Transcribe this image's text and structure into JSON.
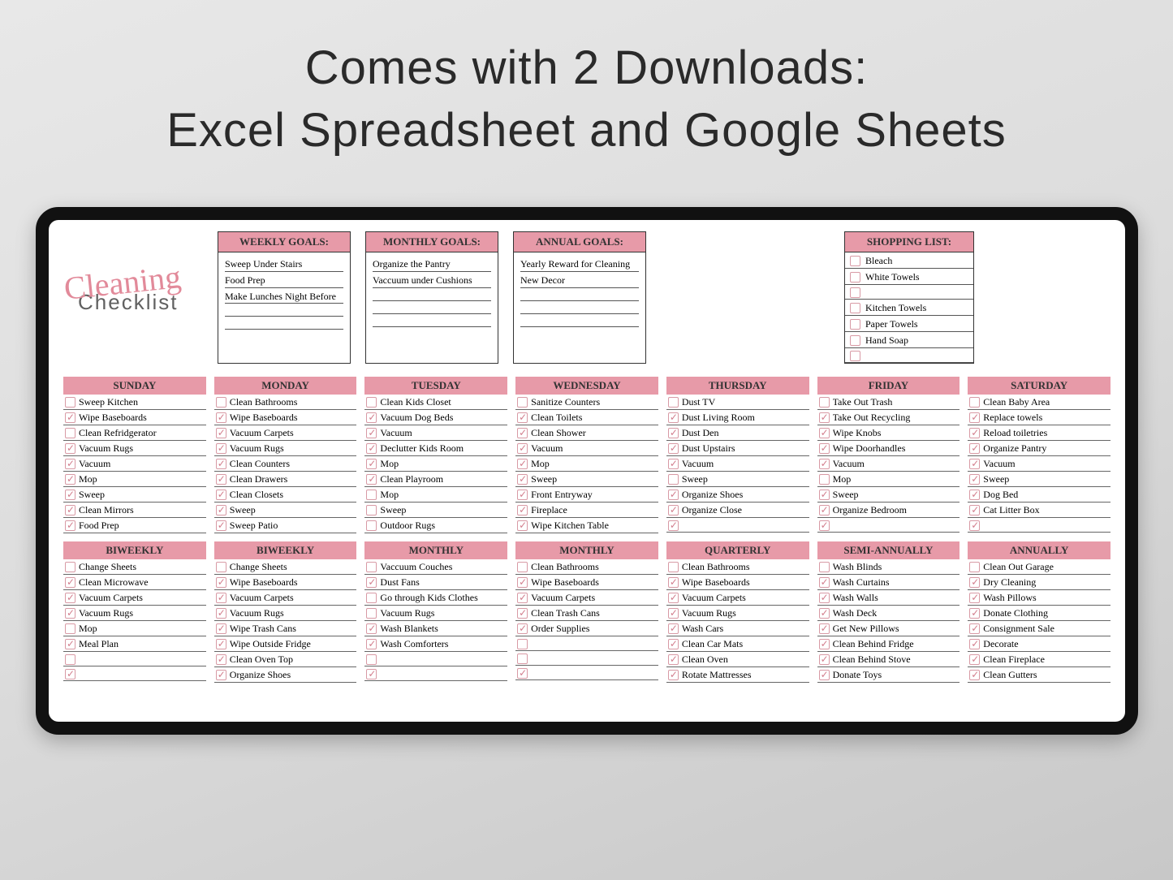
{
  "hero": {
    "line1": "Comes with 2 Downloads:",
    "line2": "Excel Spreadsheet and Google Sheets"
  },
  "logo": {
    "script": "Cleaning",
    "sub": "Checklist"
  },
  "goals": {
    "weekly": {
      "title": "WEEKLY GOALS:",
      "items": [
        "Sweep Under Stairs",
        "Food Prep",
        "Make Lunches Night Before",
        "",
        ""
      ]
    },
    "monthly": {
      "title": "MONTHLY GOALS:",
      "items": [
        "Organize the Pantry",
        "Vaccuum under Cushions",
        "",
        "",
        ""
      ]
    },
    "annual": {
      "title": "ANNUAL GOALS:",
      "items": [
        "Yearly Reward for Cleaning",
        "New Decor",
        "",
        "",
        ""
      ]
    }
  },
  "shopping": {
    "title": "SHOPPING LIST:",
    "items": [
      {
        "c": false,
        "t": "Bleach"
      },
      {
        "c": false,
        "t": "White Towels"
      },
      {
        "c": false,
        "t": ""
      },
      {
        "c": false,
        "t": "Kitchen Towels"
      },
      {
        "c": false,
        "t": "Paper Towels"
      },
      {
        "c": false,
        "t": "Hand Soap"
      },
      {
        "c": false,
        "t": ""
      }
    ]
  },
  "days": [
    {
      "h": "SUNDAY",
      "rows": [
        {
          "c": 0,
          "t": "Sweep Kitchen"
        },
        {
          "c": 1,
          "t": "Wipe Baseboards"
        },
        {
          "c": 0,
          "t": "Clean Refridgerator"
        },
        {
          "c": 1,
          "t": "Vacuum Rugs"
        },
        {
          "c": 1,
          "t": "Vacuum"
        },
        {
          "c": 1,
          "t": "Mop"
        },
        {
          "c": 1,
          "t": "Sweep"
        },
        {
          "c": 1,
          "t": "Clean Mirrors"
        },
        {
          "c": 1,
          "t": "Food Prep"
        }
      ]
    },
    {
      "h": "MONDAY",
      "rows": [
        {
          "c": 0,
          "t": "Clean Bathrooms"
        },
        {
          "c": 1,
          "t": "Wipe Baseboards"
        },
        {
          "c": 1,
          "t": "Vacuum Carpets"
        },
        {
          "c": 1,
          "t": "Vacuum Rugs"
        },
        {
          "c": 1,
          "t": "Clean Counters"
        },
        {
          "c": 1,
          "t": "Clean Drawers"
        },
        {
          "c": 1,
          "t": "Clean Closets"
        },
        {
          "c": 1,
          "t": "Sweep"
        },
        {
          "c": 1,
          "t": "Sweep Patio"
        }
      ]
    },
    {
      "h": "TUESDAY",
      "rows": [
        {
          "c": 0,
          "t": "Clean Kids Closet"
        },
        {
          "c": 1,
          "t": "Vacuum Dog Beds"
        },
        {
          "c": 1,
          "t": "Vacuum"
        },
        {
          "c": 1,
          "t": "Declutter Kids Room"
        },
        {
          "c": 1,
          "t": "Mop"
        },
        {
          "c": 1,
          "t": "Clean Playroom"
        },
        {
          "c": 0,
          "t": "Mop"
        },
        {
          "c": 0,
          "t": "Sweep"
        },
        {
          "c": 0,
          "t": "Outdoor Rugs"
        }
      ]
    },
    {
      "h": "WEDNESDAY",
      "rows": [
        {
          "c": 0,
          "t": "Sanitize Counters"
        },
        {
          "c": 1,
          "t": "Clean Toilets"
        },
        {
          "c": 1,
          "t": "Clean Shower"
        },
        {
          "c": 1,
          "t": "Vacuum"
        },
        {
          "c": 1,
          "t": "Mop"
        },
        {
          "c": 1,
          "t": "Sweep"
        },
        {
          "c": 1,
          "t": "Front Entryway"
        },
        {
          "c": 1,
          "t": "Fireplace"
        },
        {
          "c": 1,
          "t": "Wipe Kitchen Table"
        }
      ]
    },
    {
      "h": "THURSDAY",
      "rows": [
        {
          "c": 0,
          "t": "Dust TV"
        },
        {
          "c": 1,
          "t": "Dust Living Room"
        },
        {
          "c": 1,
          "t": "Dust Den"
        },
        {
          "c": 1,
          "t": "Dust Upstairs"
        },
        {
          "c": 1,
          "t": "Vacuum"
        },
        {
          "c": 0,
          "t": "Sweep"
        },
        {
          "c": 1,
          "t": "Organize Shoes"
        },
        {
          "c": 1,
          "t": "Organize Close"
        },
        {
          "c": 1,
          "t": ""
        }
      ]
    },
    {
      "h": "FRIDAY",
      "rows": [
        {
          "c": 0,
          "t": "Take Out Trash"
        },
        {
          "c": 1,
          "t": "Take Out Recycling"
        },
        {
          "c": 1,
          "t": "Wipe Knobs"
        },
        {
          "c": 1,
          "t": "Wipe Doorhandles"
        },
        {
          "c": 1,
          "t": "Vacuum"
        },
        {
          "c": 0,
          "t": "Mop"
        },
        {
          "c": 1,
          "t": "Sweep"
        },
        {
          "c": 1,
          "t": "Organize Bedroom"
        },
        {
          "c": 1,
          "t": ""
        }
      ]
    },
    {
      "h": "SATURDAY",
      "rows": [
        {
          "c": 0,
          "t": "Clean Baby Area"
        },
        {
          "c": 1,
          "t": "Replace towels"
        },
        {
          "c": 1,
          "t": "Reload toiletries"
        },
        {
          "c": 1,
          "t": "Organize Pantry"
        },
        {
          "c": 1,
          "t": "Vacuum"
        },
        {
          "c": 1,
          "t": "Sweep"
        },
        {
          "c": 1,
          "t": "Dog Bed"
        },
        {
          "c": 1,
          "t": "Cat Litter Box"
        },
        {
          "c": 1,
          "t": ""
        }
      ]
    }
  ],
  "periods": [
    {
      "h": "BIWEEKLY",
      "rows": [
        {
          "c": 0,
          "t": "Change Sheets"
        },
        {
          "c": 1,
          "t": "Clean Microwave"
        },
        {
          "c": 1,
          "t": "Vacuum Carpets"
        },
        {
          "c": 1,
          "t": "Vacuum Rugs"
        },
        {
          "c": 0,
          "t": "Mop"
        },
        {
          "c": 1,
          "t": "Meal Plan"
        },
        {
          "c": 0,
          "t": ""
        },
        {
          "c": 1,
          "t": ""
        }
      ]
    },
    {
      "h": "BIWEEKLY",
      "rows": [
        {
          "c": 0,
          "t": "Change Sheets"
        },
        {
          "c": 1,
          "t": "Wipe Baseboards"
        },
        {
          "c": 1,
          "t": "Vacuum Carpets"
        },
        {
          "c": 1,
          "t": "Vacuum Rugs"
        },
        {
          "c": 1,
          "t": "Wipe Trash Cans"
        },
        {
          "c": 1,
          "t": "Wipe Outside Fridge"
        },
        {
          "c": 1,
          "t": "Clean Oven Top"
        },
        {
          "c": 1,
          "t": "Organize Shoes"
        }
      ]
    },
    {
      "h": "MONTHLY",
      "rows": [
        {
          "c": 0,
          "t": "Vaccuum Couches"
        },
        {
          "c": 1,
          "t": "Dust Fans"
        },
        {
          "c": 0,
          "t": "Go through Kids Clothes"
        },
        {
          "c": 0,
          "t": "Vacuum Rugs"
        },
        {
          "c": 1,
          "t": "Wash Blankets"
        },
        {
          "c": 1,
          "t": "Wash Comforters"
        },
        {
          "c": 0,
          "t": ""
        },
        {
          "c": 1,
          "t": ""
        }
      ]
    },
    {
      "h": "MONTHLY",
      "rows": [
        {
          "c": 0,
          "t": "Clean Bathrooms"
        },
        {
          "c": 1,
          "t": "Wipe Baseboards"
        },
        {
          "c": 1,
          "t": "Vacuum Carpets"
        },
        {
          "c": 1,
          "t": "Clean Trash Cans"
        },
        {
          "c": 1,
          "t": "Order Supplies"
        },
        {
          "c": 0,
          "t": ""
        },
        {
          "c": 0,
          "t": ""
        },
        {
          "c": 1,
          "t": ""
        }
      ]
    },
    {
      "h": "QUARTERLY",
      "rows": [
        {
          "c": 0,
          "t": "Clean Bathrooms"
        },
        {
          "c": 1,
          "t": "Wipe Baseboards"
        },
        {
          "c": 1,
          "t": "Vacuum Carpets"
        },
        {
          "c": 1,
          "t": "Vacuum Rugs"
        },
        {
          "c": 1,
          "t": "Wash Cars"
        },
        {
          "c": 1,
          "t": "Clean Car Mats"
        },
        {
          "c": 1,
          "t": "Clean Oven"
        },
        {
          "c": 1,
          "t": "Rotate Mattresses"
        }
      ]
    },
    {
      "h": "SEMI-ANNUALLY",
      "rows": [
        {
          "c": 0,
          "t": "Wash Blinds"
        },
        {
          "c": 1,
          "t": "Wash Curtains"
        },
        {
          "c": 1,
          "t": "Wash Walls"
        },
        {
          "c": 1,
          "t": "Wash Deck"
        },
        {
          "c": 1,
          "t": "Get New Pillows"
        },
        {
          "c": 1,
          "t": "Clean Behind Fridge"
        },
        {
          "c": 1,
          "t": "Clean Behind Stove"
        },
        {
          "c": 1,
          "t": "Donate Toys"
        }
      ]
    },
    {
      "h": "ANNUALLY",
      "rows": [
        {
          "c": 0,
          "t": "Clean Out Garage"
        },
        {
          "c": 1,
          "t": "Dry Cleaning"
        },
        {
          "c": 1,
          "t": "Wash Pillows"
        },
        {
          "c": 1,
          "t": "Donate Clothing"
        },
        {
          "c": 1,
          "t": "Consignment Sale"
        },
        {
          "c": 1,
          "t": "Decorate"
        },
        {
          "c": 1,
          "t": "Clean Fireplace"
        },
        {
          "c": 1,
          "t": "Clean Gutters"
        }
      ]
    }
  ]
}
